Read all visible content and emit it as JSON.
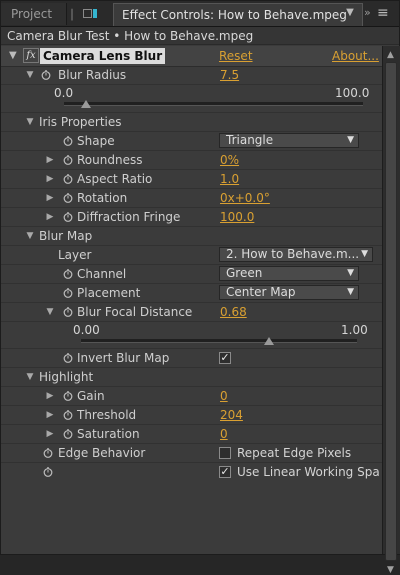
{
  "tabs": {
    "project": "Project",
    "active": "Effect Controls: How to Behave.mpeg"
  },
  "comp_line": "Camera Blur Test • How to Behave.mpeg",
  "effect": {
    "name": "Camera Lens Blur",
    "reset": "Reset",
    "about": "About..."
  },
  "props": {
    "blur_radius": {
      "label": "Blur Radius",
      "value": "7.5",
      "slider_min": "0.0",
      "slider_max": "100.0",
      "slider_pos": 0.075
    },
    "iris_properties": "Iris Properties",
    "shape": {
      "label": "Shape",
      "value": "Triangle"
    },
    "roundness": {
      "label": "Roundness",
      "value": "0%"
    },
    "aspect_ratio": {
      "label": "Aspect Ratio",
      "value": "1.0"
    },
    "rotation": {
      "label": "Rotation",
      "value": "0x+0.0°"
    },
    "diffraction_fringe": {
      "label": "Diffraction Fringe",
      "value": "100.0"
    },
    "blur_map": "Blur Map",
    "layer": {
      "label": "Layer",
      "value": "2. How to Behave.m..."
    },
    "channel": {
      "label": "Channel",
      "value": "Green"
    },
    "placement": {
      "label": "Placement",
      "value": "Center Map"
    },
    "blur_focal_distance": {
      "label": "Blur Focal Distance",
      "value": "0.68",
      "slider_min": "0.00",
      "slider_max": "1.00",
      "slider_pos": 0.68
    },
    "invert_blur_map": {
      "label": "Invert Blur Map",
      "checked": true
    },
    "highlight": "Highlight",
    "gain": {
      "label": "Gain",
      "value": "0"
    },
    "threshold": {
      "label": "Threshold",
      "value": "204"
    },
    "saturation": {
      "label": "Saturation",
      "value": "0"
    },
    "edge_behavior": {
      "label": "Edge Behavior",
      "option": "Repeat Edge Pixels",
      "checked": false
    },
    "linear": {
      "option": "Use Linear Working Spa",
      "checked": true
    }
  }
}
